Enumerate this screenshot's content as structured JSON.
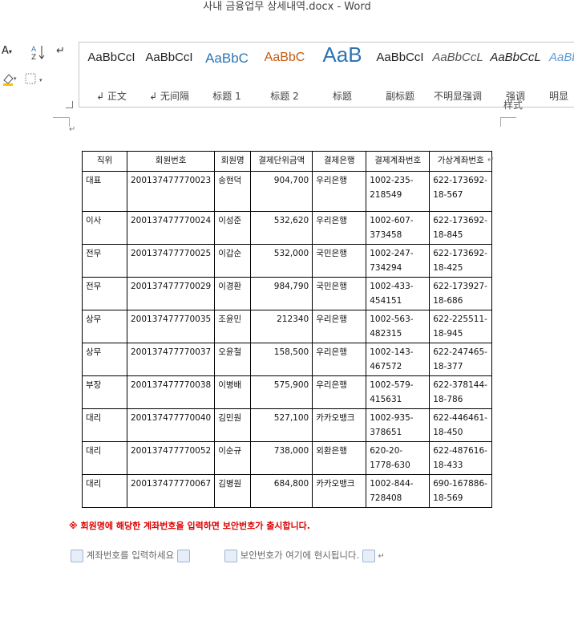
{
  "window": {
    "title": "사내 금융업무 상세내역.docx - Word"
  },
  "ribbon": {
    "styles": [
      {
        "sample": "AaBbCcI",
        "label": "↲ 正文",
        "color": "#222222"
      },
      {
        "sample": "AaBbCcI",
        "label": "↲ 无间隔",
        "color": "#222222"
      },
      {
        "sample": "AaBbC",
        "label": "标题 1",
        "color": "#2e74b5"
      },
      {
        "sample": "AaBbC",
        "label": "标题 2",
        "color": "#c55a11"
      },
      {
        "sample": "AaB",
        "label": "标题",
        "color": "#2e74b5"
      },
      {
        "sample": "AaBbCcI",
        "label": "副标题",
        "color": "#222222"
      },
      {
        "sample": "AaBbCcL",
        "label": "不明显强调",
        "color": "#555555"
      },
      {
        "sample": "AaBbCcL",
        "label": "强调",
        "color": "#222222"
      },
      {
        "sample": "AaBb",
        "label": "明显",
        "color": "#5b9bd5"
      }
    ],
    "group_label": "样式"
  },
  "table": {
    "headers": [
      "직위",
      "회원번호",
      "회원명",
      "결제단위금액",
      "결제은행",
      "결제계좌번호",
      "가상계좌번호"
    ],
    "rows": [
      [
        "대표",
        "200137477770023",
        "송현덕",
        "904,700",
        "우리은행",
        "1002-235-\n218549",
        "622-173692-\n18-567"
      ],
      [
        "이사",
        "200137477770024",
        "이성준",
        "532,620",
        "우리은행",
        "1002-607-\n373458",
        "622-173692-\n18-845"
      ],
      [
        "전무",
        "200137477770025",
        "이갑순",
        "532,000",
        "국민은행",
        "1002-247-\n734294",
        "622-173692-\n18-425"
      ],
      [
        "전무",
        "200137477770029",
        "이경환",
        "984,790",
        "국민은행",
        "1002-433-\n454151",
        "622-173927-\n18-686"
      ],
      [
        "상무",
        "200137477770035",
        "조윤민",
        "212340",
        "우리은행",
        "1002-563-\n482315",
        "622-225511-\n18-945"
      ],
      [
        "상무",
        "200137477770037",
        "오윤철",
        "158,500",
        "우리은행",
        "1002-143-\n467572",
        "622-247465-\n18-377"
      ],
      [
        "부장",
        "200137477770038",
        "이병배",
        "575,900",
        "우리은행",
        "1002-579-\n415631",
        "622-378144-\n18-786"
      ],
      [
        "대리",
        "200137477770040",
        "김민원",
        "527,100",
        "카카오뱅크",
        "1002-935-\n378651",
        "622-446461-\n18-450"
      ],
      [
        "대리",
        "200137477770052",
        "이순규",
        "738,000",
        "외환은행",
        "620-20-\n1778-630",
        "622-487616-\n18-433"
      ],
      [
        "대리",
        "200137477770067",
        "김병원",
        "684,800",
        "카카오뱅크",
        "1002-844-\n728408",
        "690-167886-\n18-569"
      ]
    ]
  },
  "notice": "※ 회원명에 해당한 계좌번호을 입력하면 보안번호가 출시합니다.",
  "fields": {
    "account_placeholder": "계좌번호를 입력하세요",
    "security_placeholder": "보안번호가 여기에 현시됩니다."
  }
}
